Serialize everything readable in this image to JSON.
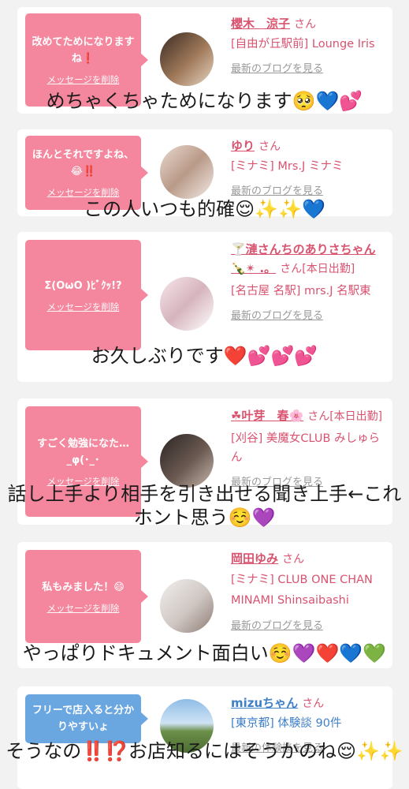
{
  "cards": [
    {
      "message": "改めてためになりますね❗",
      "delete_label": "メッセージを削除",
      "name": "櫻木　涼子",
      "honorific": "さん",
      "area": "[自由が丘駅前] Lounge Iris",
      "blog_link": "最新のブログを見る"
    },
    {
      "message": "ほんとそれですよね、😂‼️",
      "delete_label": "メッセージを削除",
      "name": "ゆり",
      "honorific": "さん",
      "area": "[ミナミ] Mrs.J ミナミ",
      "blog_link": "最新のブログを見る"
    },
    {
      "message": "Σ(OωO )ﾋﾞｸｯ!?",
      "delete_label": "メッセージを削除",
      "name": "🍸漣さんちのありさちゃん🍾✴︎ .。",
      "honorific": "さん[本日出勤]",
      "area": "[名古屋 名駅] mrs.J 名駅東",
      "blog_link": "最新のブログを見る"
    },
    {
      "message": "すごく勉強になた…_φ(･_･",
      "delete_label": "メッセージを削除",
      "name": "☘叶芽　春🌸",
      "honorific": "さん[本日出勤]",
      "area": "[刈谷] 美魔女CLUB みしゅらん",
      "blog_link": "最新のブログを見る"
    },
    {
      "message": "私もみました！😄",
      "delete_label": "メッセージを削除",
      "name": "岡田ゆみ",
      "honorific": "さん",
      "area": "[ミナミ] CLUB ONE CHAN MINAMI Shinsaibashi",
      "blog_link": "最新のブログを見る"
    },
    {
      "message": "フリーで店入ると分かりやすいょ",
      "delete_label": "",
      "name": "mizuちゃん",
      "honorific": "さん",
      "area": "[東京都] 体験談 90件",
      "blog_link": "最新の体験談を見る"
    }
  ],
  "captions": [
    "めちゃくちゃためになります🥺💙💕",
    "この人いつも的確😌✨✨💙",
    "お久しぶりです❤️💕💕💕",
    "話し上手より相手を引き出せる聞き上手←これホント思う☺️💜",
    "やっぱりドキュメント面白い☺️💜❤️💙💚",
    "そうなの‼️⁉️お店知るにはそうかのね😌✨✨"
  ],
  "colors": {
    "pink": "#f4879e",
    "blue": "#6aa6e0",
    "name_pink": "#d9536f",
    "name_blue": "#3f7fc8"
  }
}
